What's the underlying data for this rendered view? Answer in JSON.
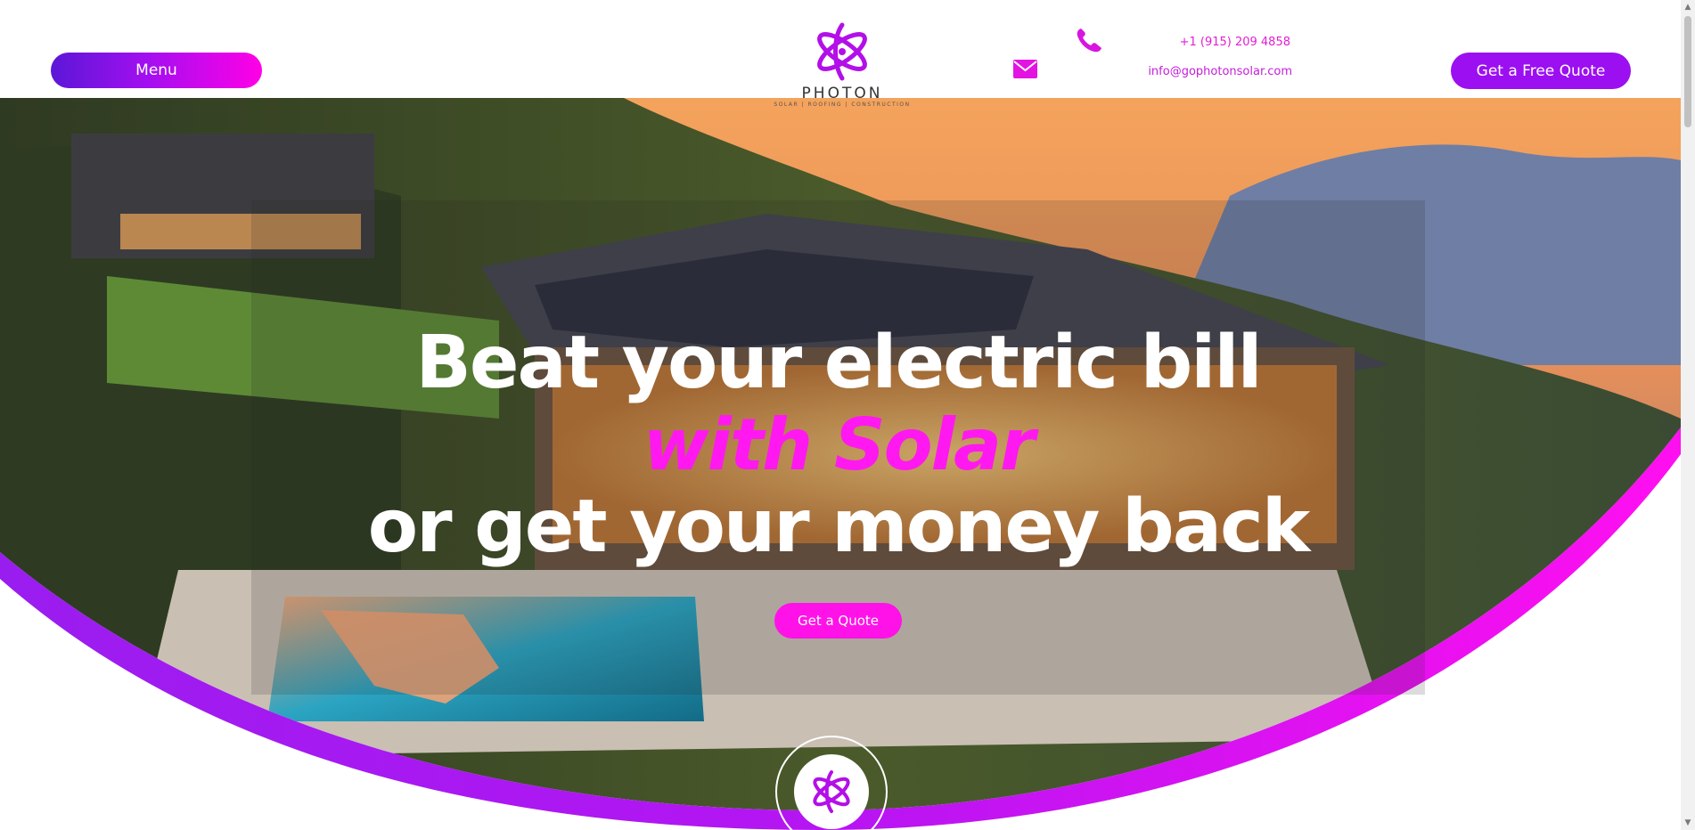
{
  "header": {
    "menu_label": "Menu",
    "logo_name": "PHOTON",
    "logo_tagline": "SOLAR | ROOFING | CONSTRUCTION",
    "phone": "+1 (915) 209 4858",
    "email": "info@gophotonsolar.com",
    "quote_label": "Get a Free Quote"
  },
  "hero": {
    "line1": "Beat your electric bill",
    "line2": "with Solar",
    "line3": "or get your money back",
    "cta_label": "Get a Quote"
  },
  "icons": {
    "phone": "phone-icon",
    "mail": "mail-icon",
    "logo": "photon-atom-logo-icon"
  },
  "colors": {
    "brand_purple": "#9c0ff1",
    "brand_magenta": "#ff12e8",
    "menu_gradient_start": "#5b17d6",
    "menu_gradient_end": "#ff00e6",
    "headline_accent": "#ff19f0"
  }
}
